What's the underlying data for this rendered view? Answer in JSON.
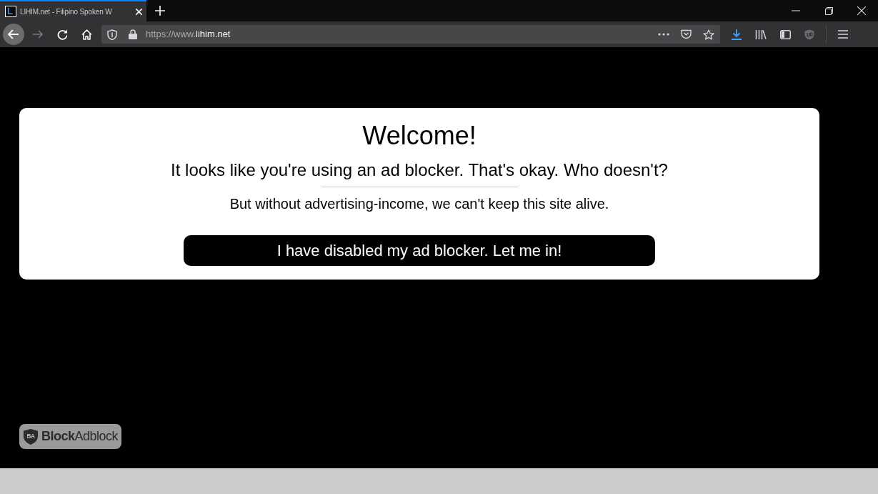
{
  "browser": {
    "tabs": [
      {
        "favicon_mark": "L",
        "title": "LIHIM.net - Filipino Spoken W",
        "selected": true
      }
    ],
    "nav_buttons": [
      {
        "kind": "back",
        "disabled": false
      },
      {
        "kind": "forward",
        "disabled": true
      },
      {
        "kind": "reload",
        "disabled": false
      },
      {
        "kind": "home",
        "disabled": false
      }
    ],
    "address": {
      "scheme": "https://www.",
      "host": "lihim.net"
    }
  },
  "dialog": {
    "title": "Welcome!",
    "subtitle": "It looks like you're using an ad blocker. That's okay. Who doesn't?",
    "message": "But without advertising-income, we can't keep this site alive.",
    "button": "I have disabled my ad blocker. Let me in!"
  },
  "badge": {
    "logo_mark": "BA",
    "label": "**Block**Adblock"
  }
}
